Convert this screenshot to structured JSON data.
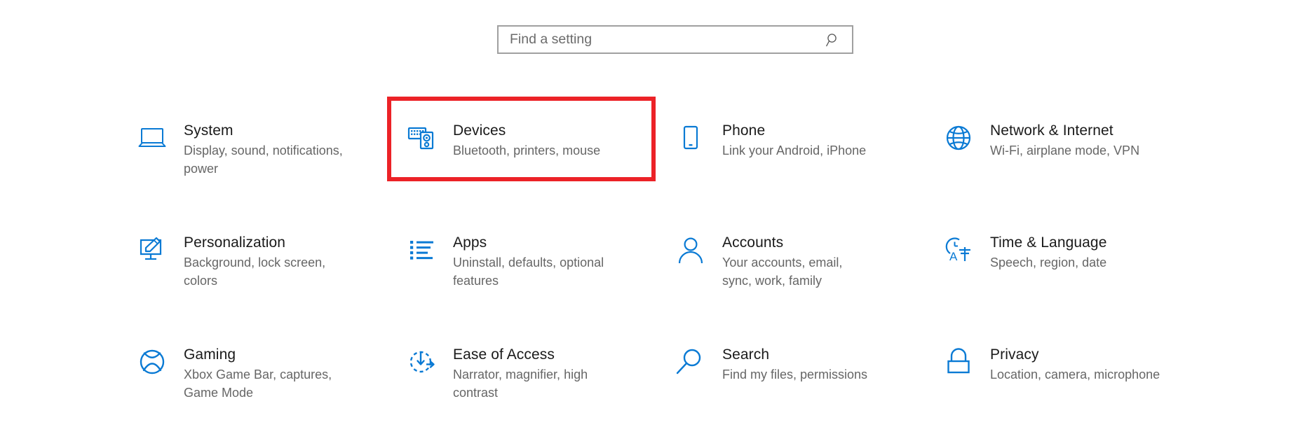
{
  "search": {
    "placeholder": "Find a setting",
    "value": "",
    "icon": "search-icon"
  },
  "highlight": {
    "color": "#ec2227",
    "target": "Devices"
  },
  "accent_color": "#0078d4",
  "tiles": [
    {
      "id": "system",
      "icon": "laptop-icon",
      "title": "System",
      "subtitle": "Display, sound, notifications, power",
      "highlighted": false
    },
    {
      "id": "devices",
      "icon": "keyboard-mouse-icon",
      "title": "Devices",
      "subtitle": "Bluetooth, printers, mouse",
      "highlighted": true
    },
    {
      "id": "phone",
      "icon": "phone-icon",
      "title": "Phone",
      "subtitle": "Link your Android, iPhone",
      "highlighted": false
    },
    {
      "id": "network-internet",
      "icon": "globe-icon",
      "title": "Network & Internet",
      "subtitle": "Wi-Fi, airplane mode, VPN",
      "highlighted": false
    },
    {
      "id": "personalization",
      "icon": "monitor-brush-icon",
      "title": "Personalization",
      "subtitle": "Background, lock screen, colors",
      "highlighted": false
    },
    {
      "id": "apps",
      "icon": "list-icon",
      "title": "Apps",
      "subtitle": "Uninstall, defaults, optional features",
      "highlighted": false
    },
    {
      "id": "accounts",
      "icon": "person-icon",
      "title": "Accounts",
      "subtitle": "Your accounts, email, sync, work, family",
      "highlighted": false
    },
    {
      "id": "time-language",
      "icon": "clock-language-icon",
      "title": "Time & Language",
      "subtitle": "Speech, region, date",
      "highlighted": false
    },
    {
      "id": "gaming",
      "icon": "xbox-icon",
      "title": "Gaming",
      "subtitle": "Xbox Game Bar, captures, Game Mode",
      "highlighted": false
    },
    {
      "id": "ease-of-access",
      "icon": "accessibility-clock-icon",
      "title": "Ease of Access",
      "subtitle": "Narrator, magnifier, high contrast",
      "highlighted": false
    },
    {
      "id": "search",
      "icon": "magnifier-icon",
      "title": "Search",
      "subtitle": "Find my files, permissions",
      "highlighted": false
    },
    {
      "id": "privacy",
      "icon": "lock-icon",
      "title": "Privacy",
      "subtitle": "Location, camera, microphone",
      "highlighted": false
    }
  ]
}
